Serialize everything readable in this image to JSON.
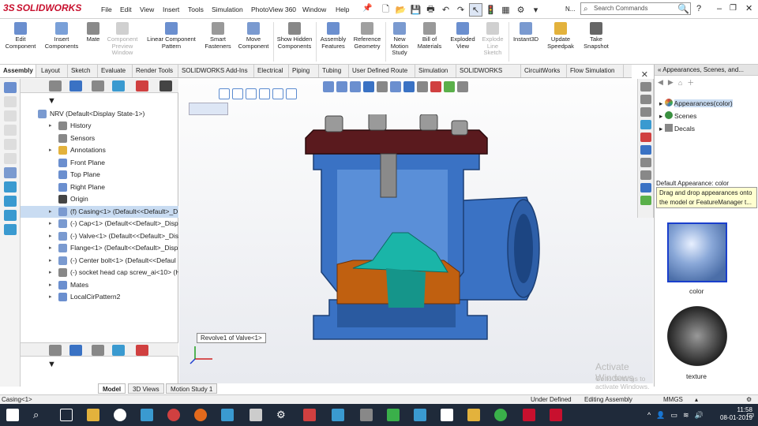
{
  "app": {
    "logo": "SOLIDWORKS"
  },
  "menu": [
    "File",
    "Edit",
    "View",
    "Insert",
    "Tools",
    "Simulation",
    "PhotoView 360",
    "Window",
    "Help"
  ],
  "search": {
    "placeholder": "Search Commands",
    "user": "N..."
  },
  "commands": [
    {
      "label": "Edit Component",
      "enabled": true
    },
    {
      "label": "Insert Components",
      "enabled": true
    },
    {
      "label": "Mate",
      "enabled": true
    },
    {
      "label": "Component Preview Window",
      "enabled": false
    },
    {
      "label": "Linear Component Pattern",
      "enabled": true
    },
    {
      "label": "Smart Fasteners",
      "enabled": true
    },
    {
      "label": "Move Component",
      "enabled": true
    },
    {
      "label": "Show Hidden Components",
      "enabled": true
    },
    {
      "label": "Assembly Features",
      "enabled": true
    },
    {
      "label": "Reference Geometry",
      "enabled": true
    },
    {
      "label": "New Motion Study",
      "enabled": true
    },
    {
      "label": "Bill of Materials",
      "enabled": true
    },
    {
      "label": "Exploded View",
      "enabled": true
    },
    {
      "label": "Explode Line Sketch",
      "enabled": false
    },
    {
      "label": "Instant3D",
      "enabled": true
    },
    {
      "label": "Update Speedpak",
      "enabled": true
    },
    {
      "label": "Take Snapshot",
      "enabled": true
    }
  ],
  "tabs": [
    "Assembly",
    "Layout",
    "Sketch",
    "Evaluate",
    "Render Tools",
    "SOLIDWORKS Add-Ins",
    "Electrical",
    "Piping",
    "Tubing",
    "User Defined Route",
    "Simulation",
    "SOLIDWORKS MBD",
    "CircuitWorks",
    "Flow Simulation"
  ],
  "tree": {
    "root": "NRV  (Default<Display State-1>)",
    "items": [
      {
        "label": "History",
        "arrow": true
      },
      {
        "label": "Sensors",
        "arrow": false
      },
      {
        "label": "Annotations",
        "arrow": true
      },
      {
        "label": "Front Plane",
        "arrow": false
      },
      {
        "label": "Top Plane",
        "arrow": false
      },
      {
        "label": "Right Plane",
        "arrow": false
      },
      {
        "label": "Origin",
        "arrow": false
      },
      {
        "label": "(f) Casing<1> (Default<<Default>_D",
        "arrow": true,
        "selected": true
      },
      {
        "label": "(-) Cap<1> (Default<<Default>_Disp",
        "arrow": true
      },
      {
        "label": "(-) Valve<1> (Default<<Default>_Dis",
        "arrow": true
      },
      {
        "label": "Flange<1> (Default<<Default>_Disp",
        "arrow": true
      },
      {
        "label": "(-) Center bolt<1> (Default<<Defaul",
        "arrow": true
      },
      {
        "label": "(-) socket head cap screw_ai<10> (H",
        "arrow": true
      },
      {
        "label": "Mates",
        "arrow": true
      },
      {
        "label": "LocalCirPattern2",
        "arrow": true
      }
    ]
  },
  "bottom_tabs": [
    "Model",
    "3D Views",
    "Motion Study 1"
  ],
  "viewport": {
    "tooltip": "Revolve1 of Valve<1>",
    "watermark_title": "Activate Windows",
    "watermark_sub": "Go to Settings to activate Windows."
  },
  "taskpane": {
    "header": "Appearances, Scenes, and...",
    "items": [
      "Appearances(color)",
      "Scenes",
      "Decals"
    ],
    "default_appearance": "Default Appearance: color",
    "hint": "Drag and drop appearances onto the model or FeatureManager t...",
    "thumbs": [
      "color",
      "texture"
    ]
  },
  "status": {
    "left": "Casing<1>",
    "defined": "Under Defined",
    "mode": "Editing Assembly",
    "units": "MMGS"
  },
  "clock": {
    "time": "11:58",
    "date": "08-01-2019"
  },
  "colors": {
    "accent": "#1a3fcc",
    "logo": "#c8102e",
    "cap": "#5a1a1e",
    "body": "#3a72c4",
    "valve": "#1ab5a8",
    "seat": "#c06010"
  }
}
